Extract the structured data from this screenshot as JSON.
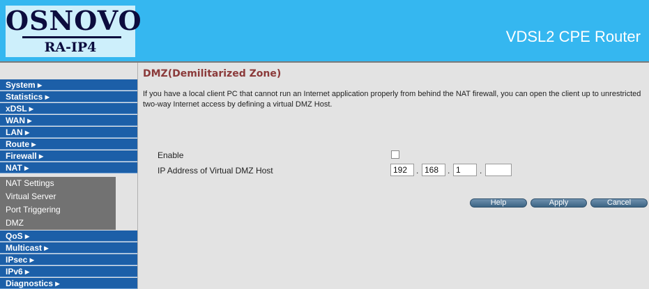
{
  "header": {
    "logo_main": "OSNOVO",
    "logo_sub": "RA-IP4",
    "title": "VDSL2 CPE Router"
  },
  "sidebar": {
    "items": [
      {
        "label": "System ▸"
      },
      {
        "label": "Statistics ▸"
      },
      {
        "label": "xDSL ▸"
      },
      {
        "label": "WAN ▸"
      },
      {
        "label": "LAN ▸"
      },
      {
        "label": "Route ▸"
      },
      {
        "label": "Firewall ▸"
      },
      {
        "label": "NAT ▸"
      }
    ],
    "nat_subitems": [
      {
        "label": "NAT Settings"
      },
      {
        "label": "Virtual Server"
      },
      {
        "label": "Port Triggering"
      },
      {
        "label": "DMZ"
      }
    ],
    "items_after": [
      {
        "label": "QoS ▸"
      },
      {
        "label": "Multicast ▸"
      },
      {
        "label": "IPsec ▸"
      },
      {
        "label": "IPv6 ▸"
      },
      {
        "label": "Diagnostics ▸"
      }
    ]
  },
  "main": {
    "title": "DMZ(Demilitarized Zone)",
    "description": "If you have a local client PC that cannot run an Internet application properly from behind the NAT firewall, you can open the client up to unrestricted two-way Internet access by defining a virtual DMZ Host.",
    "enable_label": "Enable",
    "enable_checked": false,
    "ip_label": "IP Address of Virtual DMZ Host",
    "ip": [
      "192",
      "168",
      "1",
      ""
    ],
    "ip_separator": ".",
    "buttons": {
      "help": "Help",
      "apply": "Apply",
      "cancel": "Cancel"
    }
  }
}
